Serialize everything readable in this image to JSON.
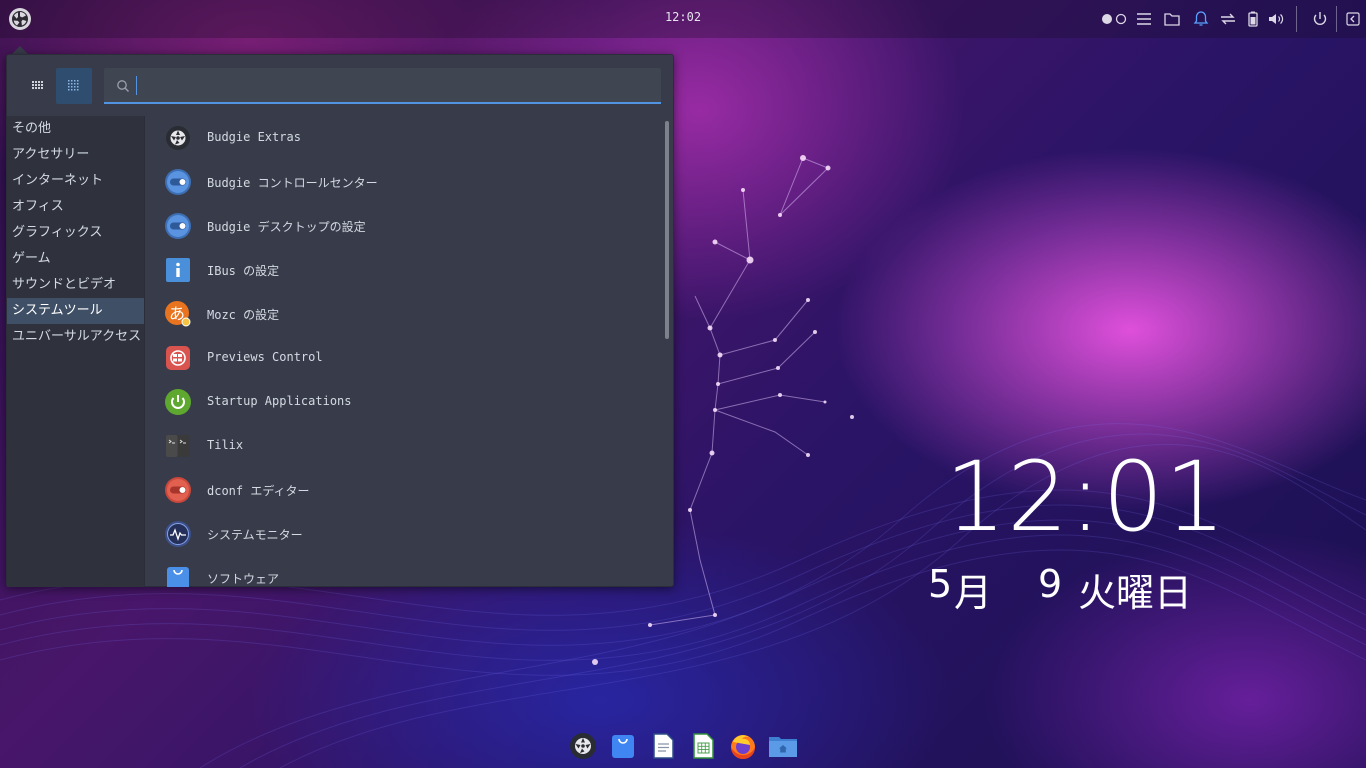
{
  "panel": {
    "clock": "12:02",
    "tray_icons": [
      "workspace-1-icon",
      "workspace-2-icon",
      "raven-menu-icon",
      "folder-icon",
      "notification-bell-icon",
      "network-icon",
      "battery-icon",
      "volume-icon",
      "power-icon",
      "raven-toggle-icon"
    ]
  },
  "menu": {
    "search": {
      "value": "",
      "placeholder": ""
    },
    "categories": [
      {
        "label": "その他"
      },
      {
        "label": "アクセサリー"
      },
      {
        "label": "インターネット"
      },
      {
        "label": "オフィス"
      },
      {
        "label": "グラフィックス"
      },
      {
        "label": "ゲーム"
      },
      {
        "label": "サウンドとビデオ"
      },
      {
        "label": "システムツール",
        "selected": true
      },
      {
        "label": "ユニバーサルアクセス"
      }
    ],
    "apps": [
      {
        "label": "Budgie Extras",
        "icon": "budgie-logo-icon"
      },
      {
        "label": "Budgie コントロールセンター",
        "icon": "budgie-control-icon"
      },
      {
        "label": "Budgie デスクトップの設定",
        "icon": "budgie-desktop-settings-icon"
      },
      {
        "label": "IBus の設定",
        "icon": "ibus-info-icon"
      },
      {
        "label": "Mozc の設定",
        "icon": "mozc-icon"
      },
      {
        "label": "Previews Control",
        "icon": "previews-control-icon"
      },
      {
        "label": "Startup Applications",
        "icon": "startup-power-icon"
      },
      {
        "label": "Tilix",
        "icon": "tilix-terminal-icon"
      },
      {
        "label": "dconf エディター",
        "icon": "dconf-editor-icon"
      },
      {
        "label": "システムモニター",
        "icon": "system-monitor-icon"
      },
      {
        "label": "ソフトウェア",
        "icon": "software-bag-icon"
      }
    ]
  },
  "desktop": {
    "time": "12:01",
    "month": "5",
    "month_unit": "月",
    "day": "9",
    "weekday": "火曜日"
  },
  "dock": {
    "items": [
      "budgie-logo-icon",
      "software-center-icon",
      "text-editor-icon",
      "spreadsheet-icon",
      "firefox-icon",
      "files-icon"
    ]
  },
  "colors": {
    "menu_bg": "#383c4a",
    "sidebar_bg": "#2f323d",
    "accent": "#5294e2",
    "selected": "#3f4f66"
  }
}
